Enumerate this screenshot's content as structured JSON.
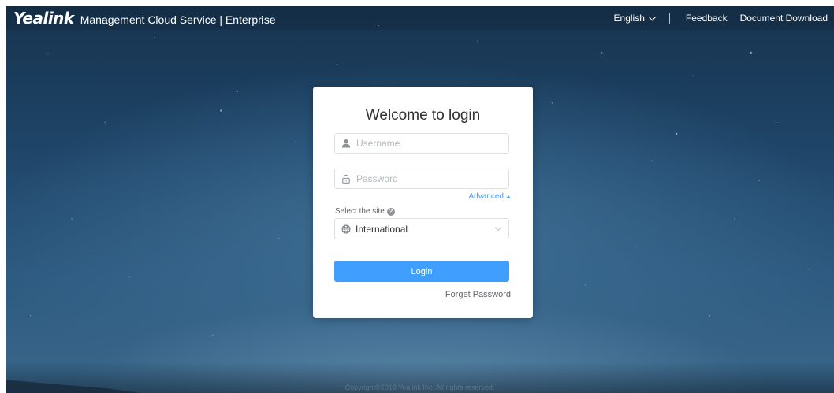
{
  "header": {
    "logo": "Yealink",
    "product": "Management Cloud Service | Enterprise",
    "language": "English",
    "feedback": "Feedback",
    "document_download": "Document Download"
  },
  "login": {
    "title": "Welcome to login",
    "username_placeholder": "Username",
    "password_placeholder": "Password",
    "advanced": "Advanced",
    "site_label": "Select the site",
    "site_help": "?",
    "site_value": "International",
    "login_button": "Login",
    "forget_password": "Forget Password"
  },
  "footer": {
    "copyright": "Copyright©2018 Yealink Inc. All rights reserved."
  },
  "icons": {
    "user": "user-icon",
    "lock": "lock-icon",
    "globe": "globe-icon",
    "help": "question-icon"
  },
  "colors": {
    "primary": "#409eff",
    "card": "#ffffff",
    "text": "#303133"
  }
}
